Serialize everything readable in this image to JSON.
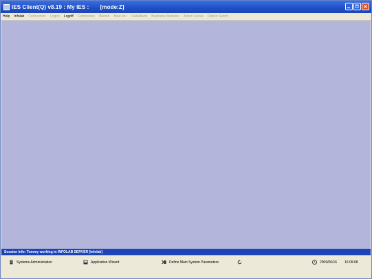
{
  "window": {
    "title": "IES Client(Q) v8.19 : My IES :       [mode:Z]"
  },
  "menu": [
    {
      "label": "Help",
      "enabled": true
    },
    {
      "label": "Infolab",
      "enabled": true
    },
    {
      "label": "Connectors",
      "enabled": false
    },
    {
      "label": "Logon",
      "enabled": false
    },
    {
      "label": "Logoff",
      "enabled": true
    },
    {
      "label": "Companies",
      "enabled": false
    },
    {
      "label": "Wizard",
      "enabled": false
    },
    {
      "label": "How do I",
      "enabled": false
    },
    {
      "label": "DataMarts",
      "enabled": false
    },
    {
      "label": "Business Modules",
      "enabled": false
    },
    {
      "label": "Action Focus",
      "enabled": false
    },
    {
      "label": "Option Select",
      "enabled": false
    }
  ],
  "session": {
    "info": "Session Info: Tommy working in INFOLAB SERVER  [infolab]"
  },
  "statusbar": {
    "systems_admin": "Systems Administration",
    "app_wizard": "Application Wizard",
    "define_params": "Define Main System Parameters",
    "date": "2009/06/16",
    "time": "16:09:08"
  },
  "colors": {
    "workspace": "#b3b5da",
    "titlebar": "#1f4fc7",
    "session_bar": "#1d43b8"
  },
  "icons": [
    "app-icon",
    "minimize-icon",
    "maximize-icon",
    "close-icon",
    "server-icon",
    "wizard-icon",
    "parameters-icon",
    "refresh-icon",
    "clock-icon"
  ]
}
